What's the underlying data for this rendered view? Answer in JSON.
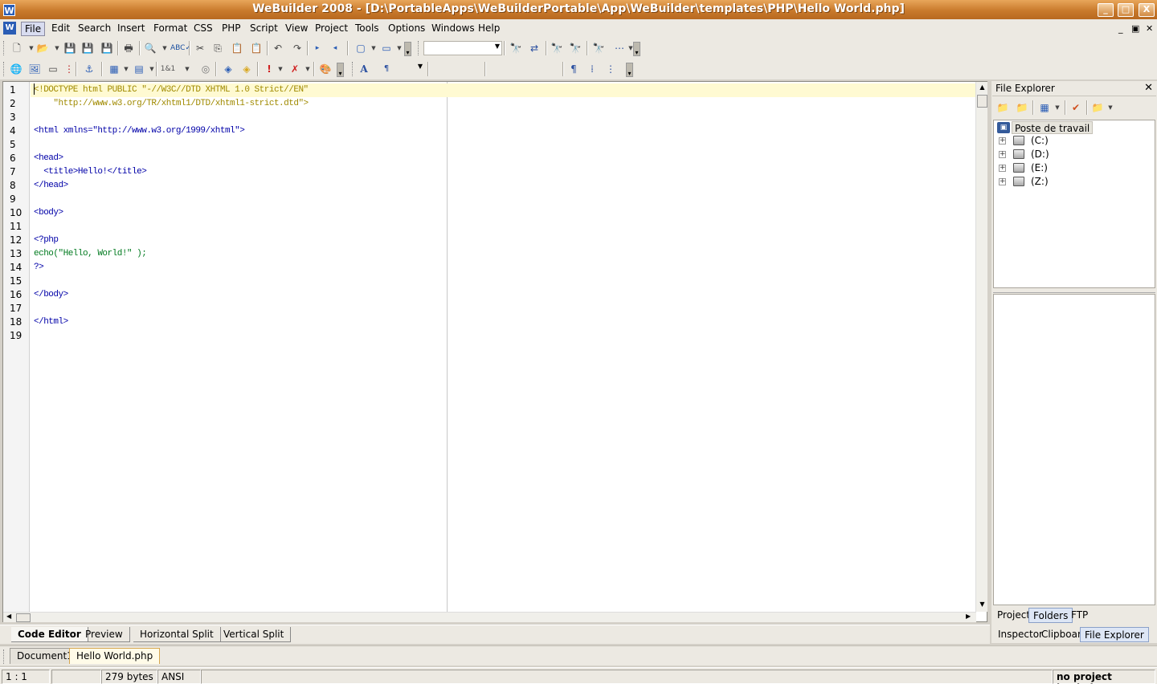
{
  "window": {
    "title": "WeBuilder 2008 - [D:\\PortableApps\\WeBuilderPortable\\App\\WeBuilder\\templates\\PHP\\Hello World.php]",
    "app_icon": "W",
    "minimize": "_",
    "maximize": "□",
    "close": "X"
  },
  "menubar": {
    "items": [
      "File",
      "Edit",
      "Search",
      "Insert",
      "Format",
      "CSS",
      "PHP",
      "Script",
      "View",
      "Project",
      "Tools",
      "Options",
      "Windows",
      "Help"
    ],
    "mdi_minimize": "_",
    "mdi_restore": "▣",
    "mdi_close": "✕"
  },
  "toolbar2": {
    "bold_font": "A",
    "paragraph": "¶",
    "html_num": "1&1"
  },
  "toolbar1": {
    "paragraph_mark": "¶"
  },
  "editor": {
    "line_numbers": [
      "1",
      "2",
      "3",
      "4",
      "5",
      "6",
      "7",
      "8",
      "9",
      "10",
      "11",
      "12",
      "13",
      "14",
      "15",
      "16",
      "17",
      "18",
      "19"
    ],
    "lines": [
      {
        "text": "<!DOCTYPE html PUBLIC \"-//W3C//DTD XHTML 1.0 Strict//EN\"",
        "color": "gold"
      },
      {
        "text": "    \"http://www.w3.org/TR/xhtml1/DTD/xhtml1-strict.dtd\">",
        "color": "gold"
      },
      {
        "text": "",
        "color": "dark"
      },
      {
        "text": "<html xmlns=\"http://www.w3.org/1999/xhtml\">",
        "color": "blue"
      },
      {
        "text": "",
        "color": "dark"
      },
      {
        "text": "<head>",
        "color": "blue"
      },
      {
        "text": "  <title>Hello!</title>",
        "color": "blue"
      },
      {
        "text": "</head>",
        "color": "blue"
      },
      {
        "text": "",
        "color": "dark"
      },
      {
        "text": "<body>",
        "color": "blue"
      },
      {
        "text": "",
        "color": "dark"
      },
      {
        "text": "<?php",
        "color": "blue"
      },
      {
        "text": "echo(\"Hello, World!\" );",
        "color": "green"
      },
      {
        "text": "?>",
        "color": "blue"
      },
      {
        "text": "",
        "color": "dark"
      },
      {
        "text": "</body>",
        "color": "blue"
      },
      {
        "text": "",
        "color": "dark"
      },
      {
        "text": "</html>",
        "color": "blue"
      },
      {
        "text": "",
        "color": "dark"
      }
    ],
    "current_line": 1
  },
  "view_tabs": [
    "Code Editor",
    "Preview",
    "Horizontal Split",
    "Vertical Split"
  ],
  "active_view_tab": "Code Editor",
  "document_tabs": [
    "Document1",
    "Hello World.php"
  ],
  "active_document_tab": "Hello World.php",
  "statusbar": {
    "position": "1 : 1",
    "modified": "",
    "size": "279 bytes",
    "encoding": "ANSI",
    "project": "no project loaded"
  },
  "file_explorer": {
    "title": "File Explorer",
    "close": "✕",
    "root": "Poste de travail",
    "drives": [
      "(C:)",
      "(D:)",
      "(E:)",
      "(Z:)"
    ],
    "expand_glyph": "+",
    "tabs_top": [
      "Project",
      "Folders",
      "FTP"
    ],
    "active_tab_top": "Folders",
    "tabs_bottom": [
      "Inspector",
      "Clipboard",
      "File Explorer"
    ],
    "active_tab_bottom": "File Explorer"
  },
  "colors": {
    "title_bar": "#c97a2c",
    "current_line": "#fffad2",
    "doctype_text": "#a08a00",
    "tag_text": "#0000a8",
    "string_text": "#007a1f"
  }
}
